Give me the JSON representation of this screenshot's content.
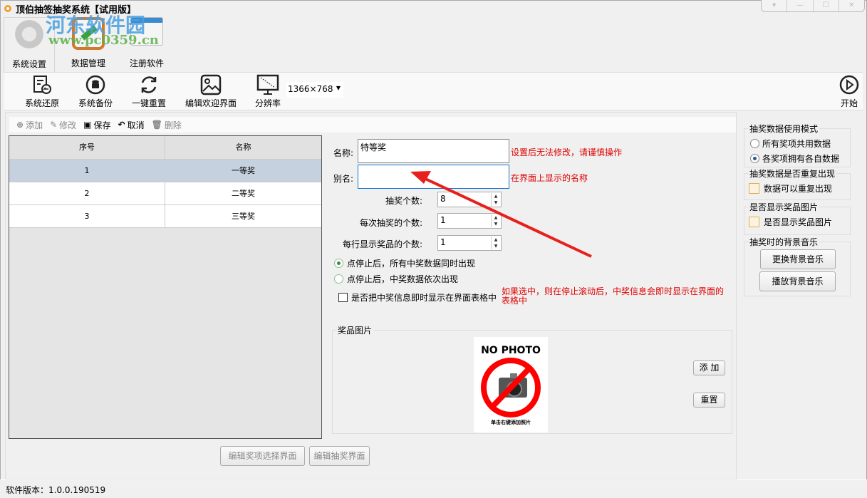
{
  "window": {
    "title": "顶伯抽签抽奖系统【试用版】",
    "controls": [
      "▾",
      "—",
      "☐",
      "✕"
    ]
  },
  "watermark": {
    "name": "河东软件园",
    "url": "www.pc0359.cn"
  },
  "ribbon_tabs": [
    {
      "label": "系统设置"
    },
    {
      "label": "数据管理"
    },
    {
      "label": "注册软件"
    }
  ],
  "toolbar": {
    "restore": "系统还原",
    "backup": "系统备份",
    "reset": "一键重置",
    "edit_welcome": "编辑欢迎界面",
    "resolution_label": "分辨率",
    "resolution_value": "1366×768",
    "start": "开始"
  },
  "subtoolbar": {
    "add": "添加",
    "edit": "修改",
    "save": "保存",
    "cancel": "取消",
    "delete": "删除"
  },
  "table": {
    "columns": [
      "序号",
      "名称"
    ],
    "rows": [
      [
        "1",
        "一等奖"
      ],
      [
        "2",
        "二等奖"
      ],
      [
        "3",
        "三等奖"
      ]
    ]
  },
  "form": {
    "name_label": "名称:",
    "name_value": "特等奖",
    "name_hint": "设置后无法修改，请谨慎操作",
    "alias_label": "别名:",
    "alias_value": "",
    "alias_hint": "在界面上显示的名称",
    "count_label": "抽奖个数:",
    "count_value": "8",
    "per_draw_label": "每次抽奖的个数:",
    "per_draw_value": "1",
    "per_row_label": "每行显示奖品的个数:",
    "per_row_value": "1",
    "radio1": "点停止后，所有中奖数据同时出现",
    "radio2": "点停止后，中奖数据依次出现",
    "show_in_table": "是否把中奖信息即时显示在界面表格中",
    "show_in_table_hint": "如果选中，则在停止滚动后，中奖信息会即时显示在界面的表格中",
    "photo_group": "奖品图片",
    "photo_title": "NO PHOTO",
    "photo_caption": "单击右键添加照片",
    "photo_add": "添 加",
    "photo_reset": "重置"
  },
  "bottom_buttons": {
    "edit_select": "编辑奖项选择界面",
    "edit_draw": "编辑抽奖界面"
  },
  "right": {
    "mode_group": "抽奖数据使用模式",
    "mode_shared": "所有奖项共用数据",
    "mode_own": "各奖项拥有各自数据",
    "repeat_group": "抽奖数据是否重复出现",
    "repeat_check": "数据可以重复出现",
    "image_group": "是否显示奖品图片",
    "image_check": "是否显示奖品图片",
    "music_group": "抽奖时的背景音乐",
    "change_music": "更换背景音乐",
    "play_music": "播放背景音乐"
  },
  "status": {
    "version": "软件版本：1.0.0.190519"
  },
  "colors": {
    "hint": "#e00000",
    "selected_row": "#c5d1df",
    "arrow": "#e8201c"
  }
}
